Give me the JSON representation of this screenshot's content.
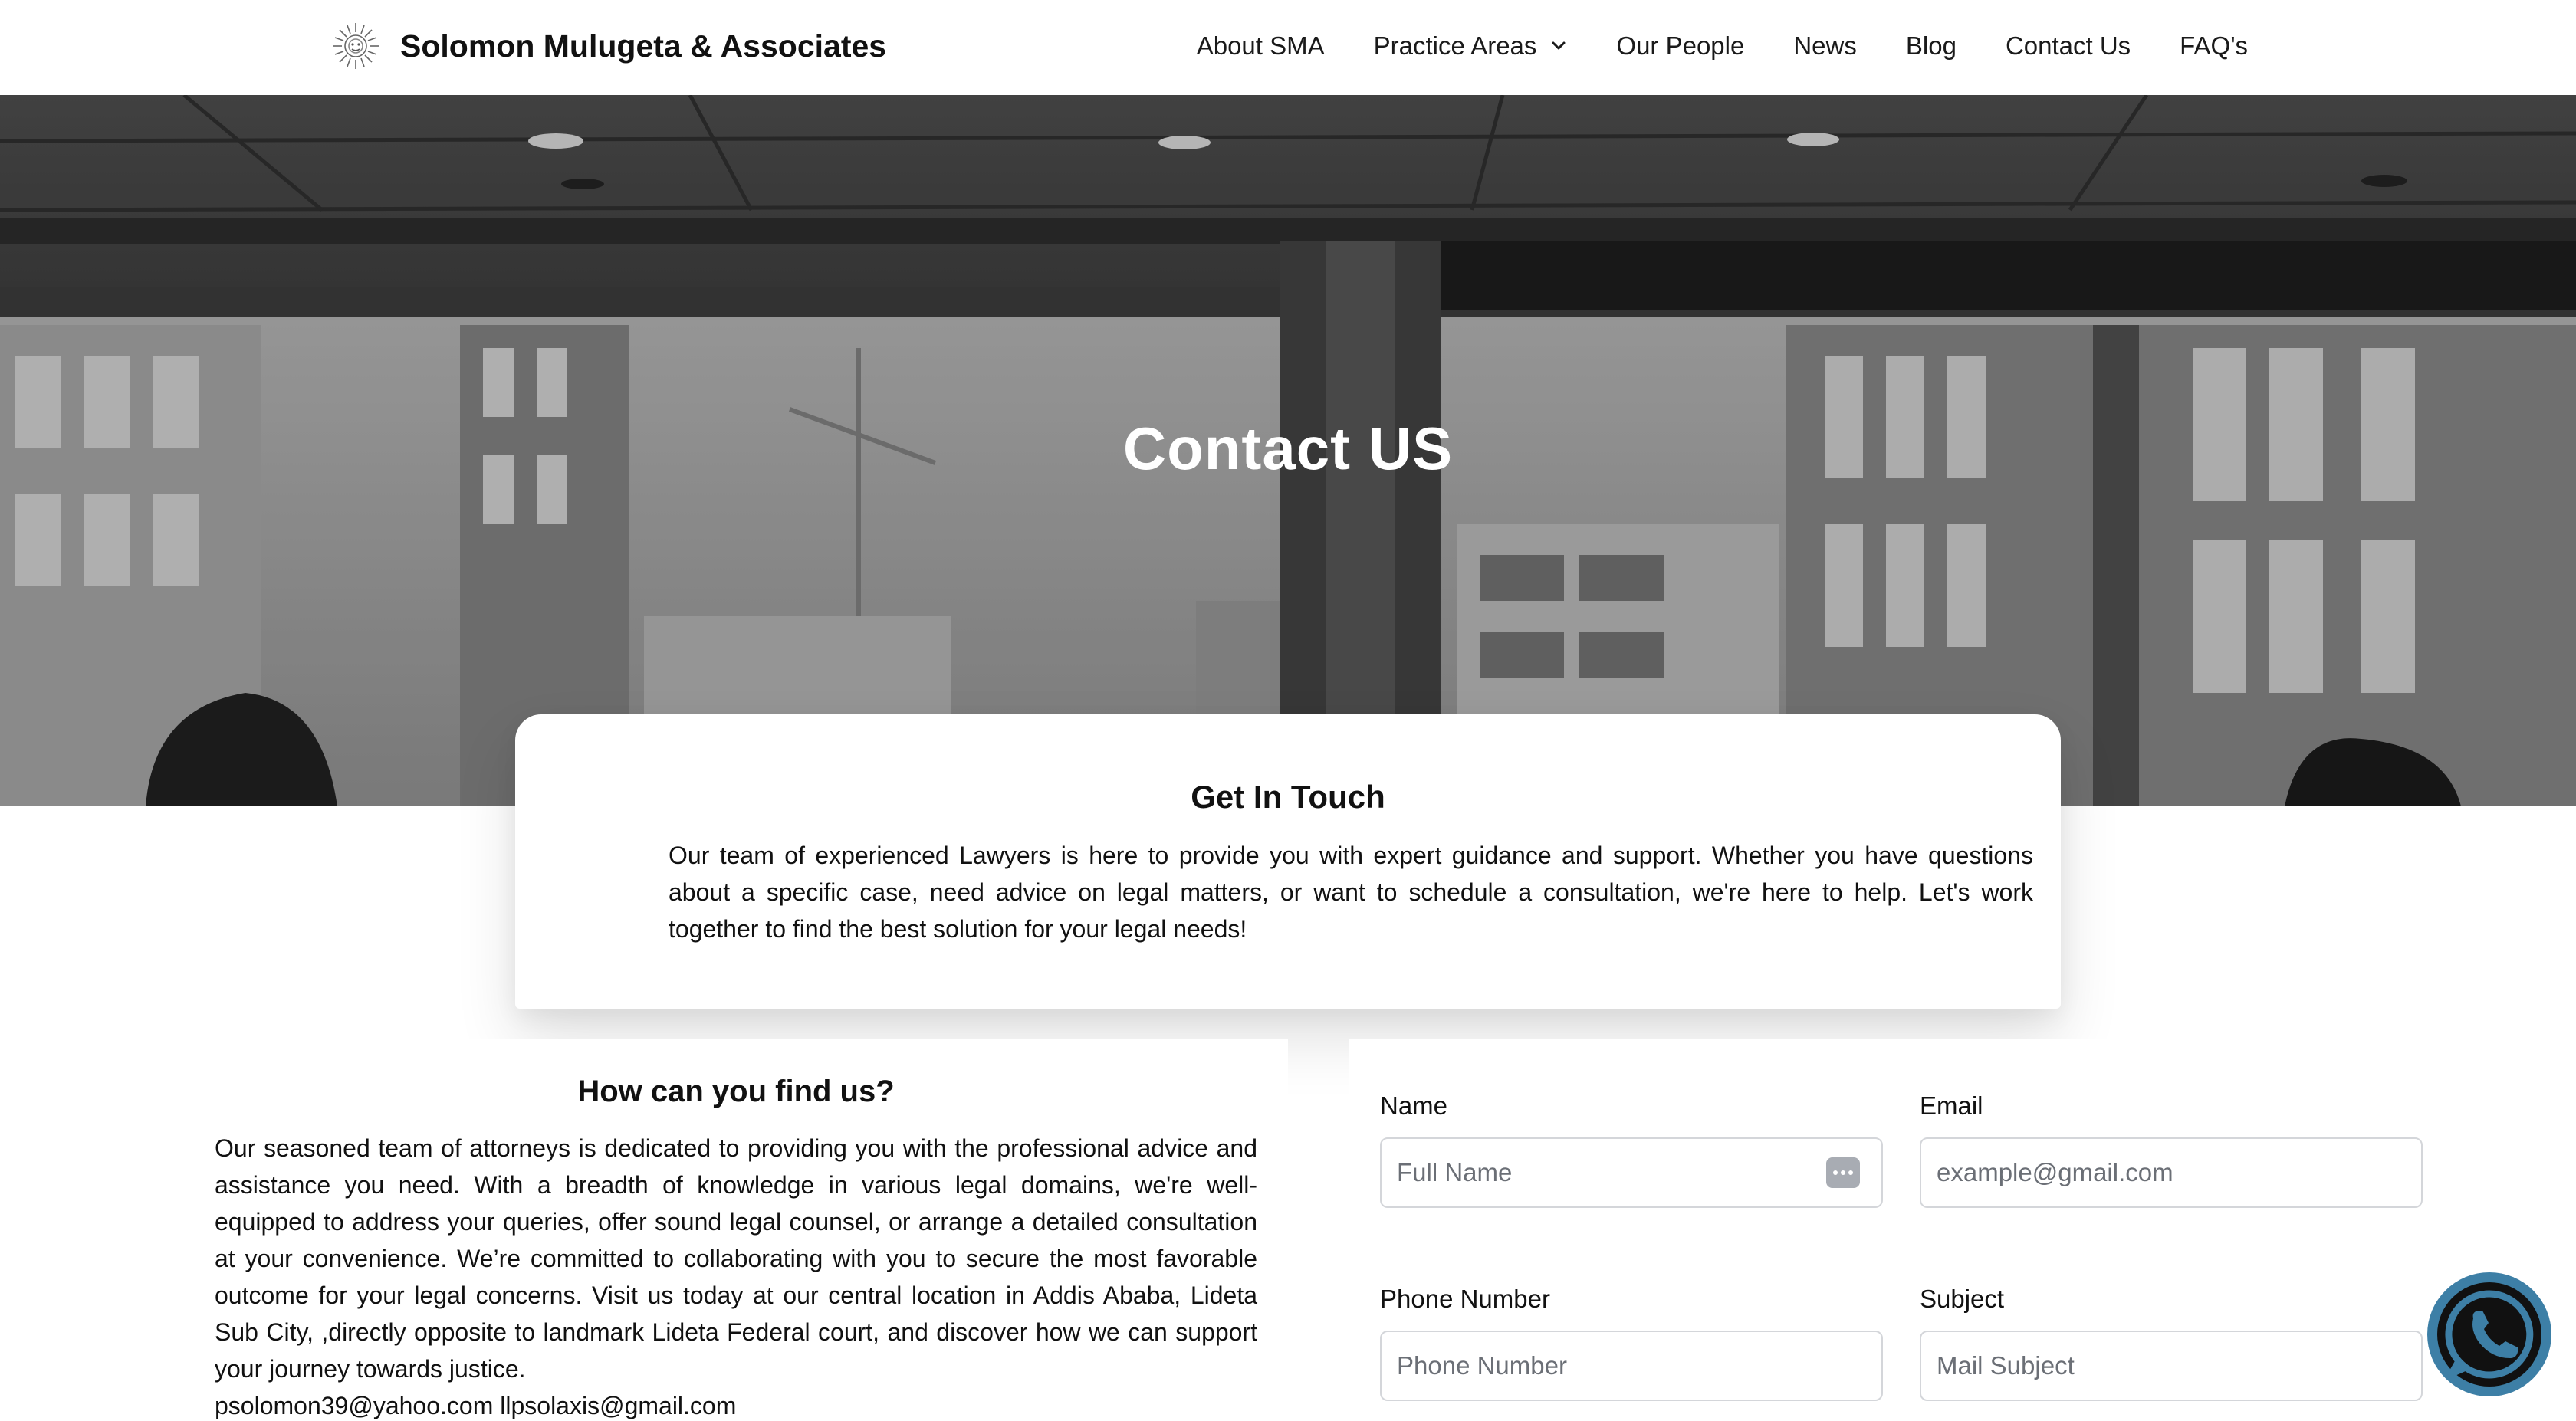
{
  "header": {
    "brand_name": "Solomon Mulugeta & Associates",
    "logo_icon": "sun-seal-logo",
    "nav": [
      {
        "label": "About SMA"
      },
      {
        "label": "Practice Areas",
        "has_dropdown": true
      },
      {
        "label": "Our People"
      },
      {
        "label": "News"
      },
      {
        "label": "Blog"
      },
      {
        "label": "Contact Us"
      },
      {
        "label": "FAQ's"
      }
    ]
  },
  "hero": {
    "title": "Contact US"
  },
  "get_in_touch": {
    "title": "Get In Touch",
    "text": "Our team of experienced Lawyers is here to provide you with expert guidance and support. Whether you have questions about a specific case, need advice on legal matters, or want to schedule a consultation, we're here to help. Let's work together to find the best solution for your legal needs!"
  },
  "find_us": {
    "title": "How can you find us?",
    "text": "Our seasoned team of attorneys is dedicated to providing you with the professional advice and assistance you need. With a breadth of knowledge in various legal domains, we're well-equipped to address your queries, offer sound legal counsel, or arrange a detailed consultation at your convenience. We’re committed to collaborating with you to secure the most favorable outcome for your legal concerns. Visit us today at our central location in Addis Ababa, Lideta Sub City, ,directly opposite to landmark Lideta Federal court, and discover how we can support your journey towards justice.",
    "emails": "psolomon39@yahoo.com llpsolaxis@gmail.com"
  },
  "form": {
    "name": {
      "label": "Name",
      "placeholder": "Full Name"
    },
    "email": {
      "label": "Email",
      "placeholder": "example@gmail.com"
    },
    "phone": {
      "label": "Phone Number",
      "placeholder": "Phone Number"
    },
    "subject": {
      "label": "Subject",
      "placeholder": "Mail Subject"
    }
  },
  "whatsapp": {
    "icon": "whatsapp-icon",
    "color": "#3d7fa6"
  },
  "colors": {
    "text": "#111111",
    "input_border": "#d4d6da",
    "hero_overlay": "#8f8f8f"
  }
}
